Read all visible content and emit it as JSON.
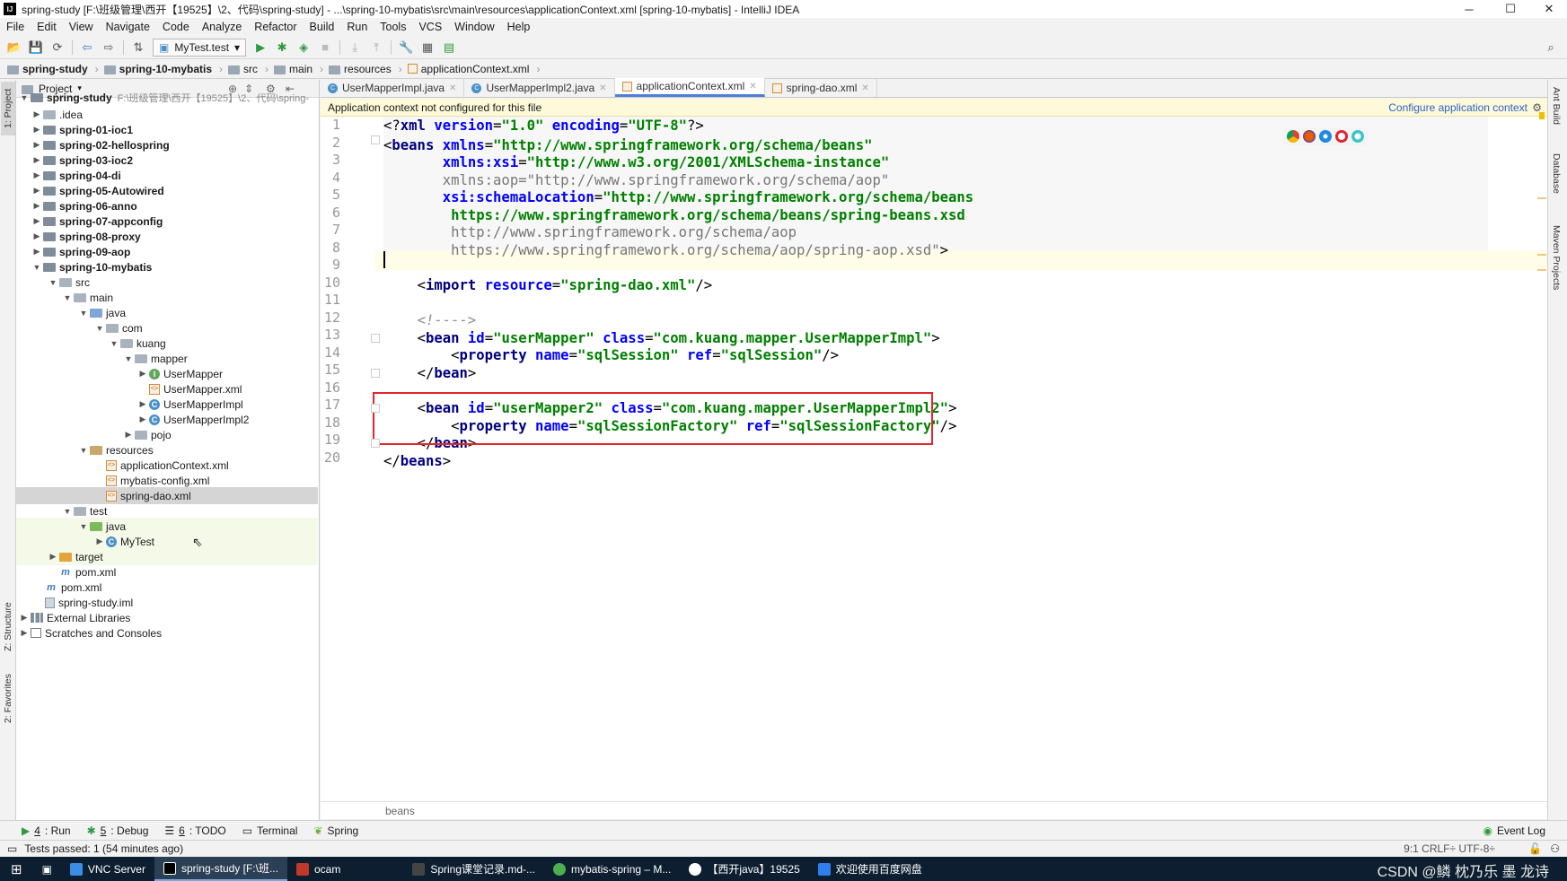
{
  "window": {
    "title": "spring-study [F:\\班级管理\\西开【19525】\\2、代码\\spring-study] - ...\\spring-10-mybatis\\src\\main\\resources\\applicationContext.xml [spring-10-mybatis] - IntelliJ IDEA",
    "controls": [
      "─",
      "☐",
      "✕"
    ]
  },
  "menu": [
    "File",
    "Edit",
    "View",
    "Navigate",
    "Code",
    "Analyze",
    "Refactor",
    "Build",
    "Run",
    "Tools",
    "VCS",
    "Window",
    "Help"
  ],
  "toolbar": {
    "run_config": "MyTest.test"
  },
  "breadcrumb": [
    "spring-study",
    "spring-10-mybatis",
    "src",
    "main",
    "resources",
    "applicationContext.xml"
  ],
  "left_stripe": {
    "project": "1: Project",
    "structure": "Z: Structure",
    "favorites": "2: Favorites"
  },
  "right_stripe": {
    "ant": "Ant Build",
    "database": "Database",
    "maven": "Maven Projects"
  },
  "project_panel": {
    "header": "Project",
    "root_name": "spring-study",
    "root_path": "F:\\班级管理\\西开【19525】\\2、代码\\spring-",
    "items": [
      {
        "label": "idea",
        "prefix": "."
      },
      {
        "label": "spring-01-ioc1"
      },
      {
        "label": "spring-02-hellospring"
      },
      {
        "label": "spring-03-ioc2"
      },
      {
        "label": "spring-04-di"
      },
      {
        "label": "spring-05-Autowired"
      },
      {
        "label": "spring-06-anno"
      },
      {
        "label": "spring-07-appconfig"
      },
      {
        "label": "spring-08-proxy"
      },
      {
        "label": "spring-09-aop"
      },
      {
        "label": "spring-10-mybatis"
      },
      {
        "label": "src"
      },
      {
        "label": "main"
      },
      {
        "label": "java"
      },
      {
        "label": "com"
      },
      {
        "label": "kuang"
      },
      {
        "label": "mapper"
      },
      {
        "label": "UserMapper"
      },
      {
        "label": "UserMapper.xml"
      },
      {
        "label": "UserMapperImpl"
      },
      {
        "label": "UserMapperImpl2"
      },
      {
        "label": "pojo"
      },
      {
        "label": "resources"
      },
      {
        "label": "applicationContext.xml"
      },
      {
        "label": "mybatis-config.xml"
      },
      {
        "label": "spring-dao.xml"
      },
      {
        "label": "test"
      },
      {
        "label": "java"
      },
      {
        "label": "MyTest"
      },
      {
        "label": "target"
      },
      {
        "label": "pom.xml"
      },
      {
        "label": "pom.xml"
      },
      {
        "label": "spring-study.iml"
      },
      {
        "label": "External Libraries"
      },
      {
        "label": "Scratches and Consoles"
      }
    ]
  },
  "tabs": [
    "UserMapperImpl.java",
    "UserMapperImpl2.java",
    "applicationContext.xml",
    "spring-dao.xml"
  ],
  "notice": {
    "text": "Application context not configured for this file",
    "link": "Configure application context"
  },
  "editor": {
    "line_numbers": [
      "1",
      "2",
      "3",
      "4",
      "5",
      "6",
      "7",
      "8",
      "9",
      "10",
      "11",
      "12",
      "13",
      "14",
      "15",
      "16",
      "17",
      "18",
      "19",
      "20"
    ],
    "footer": "beans"
  },
  "tool_tabs": [
    {
      "num": "4",
      "label": ": Run"
    },
    {
      "num": "5",
      "label": ": Debug"
    },
    {
      "num": "6",
      "label": ": TODO"
    },
    {
      "num": "",
      "label": "Terminal"
    },
    {
      "num": "",
      "label": "Spring"
    }
  ],
  "event_log": "Event Log",
  "status": {
    "text": "Tests passed: 1 (54 minutes ago)",
    "right": "9:1   CRLF÷   UTF-8÷"
  },
  "taskbar": [
    "VNC Server",
    "spring-study [F:\\班...",
    "ocam",
    "Spring课堂记录.md-...",
    "mybatis-spring – M...",
    "【西开java】19525",
    "欢迎使用百度网盘"
  ],
  "watermark": "CSDN @鳞 枕乃乐 墨 龙诗"
}
